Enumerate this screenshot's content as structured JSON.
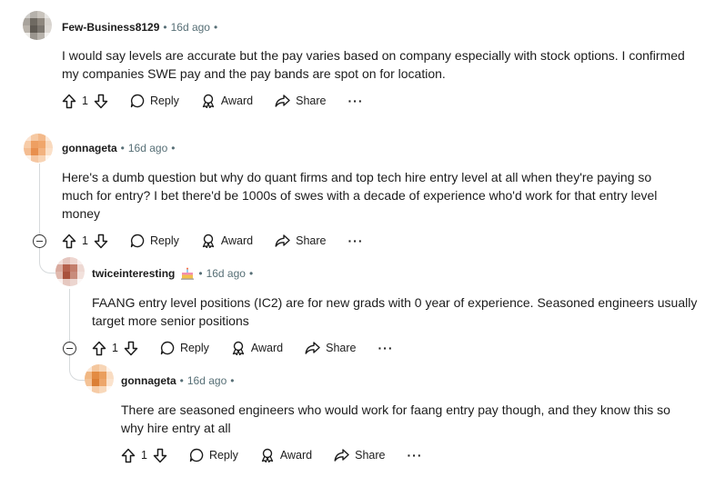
{
  "icons": {
    "upvote": "arrow-up-icon",
    "downvote": "arrow-down-icon",
    "reply": "speech-bubble-icon",
    "award": "award-icon",
    "share": "share-arrow-icon",
    "more": "ellipsis-icon",
    "collapse": "minus-circle-icon"
  },
  "labels": {
    "reply": "Reply",
    "award": "Award",
    "share": "Share",
    "more": "···",
    "separator": "•"
  },
  "comments": [
    {
      "author": "Few-Business8129",
      "time": "16d ago",
      "lines": [
        "I would say levels are accurate but the pay varies based on company especially with stock options. I confirmed",
        "my companies SWE pay and the pay bands are spot on for location."
      ],
      "votes": "1"
    },
    {
      "author": "gonnageta",
      "time": "16d ago",
      "lines": [
        "Here's a dumb question but why do quant firms and top tech hire entry level at all when they're paying so",
        "much for entry? I bet there'd be 1000s of swes with a decade of experience who'd work for that entry level",
        "money"
      ],
      "votes": "1"
    },
    {
      "author": "twiceinteresting",
      "time": "16d ago",
      "lines": [
        "FAANG entry level positions (IC2) are for new grads with 0 year of experience. Seasoned engineers usually",
        "target more senior positions"
      ],
      "votes": "1"
    },
    {
      "author": "gonnageta",
      "time": "16d ago",
      "lines": [
        "There are seasoned engineers who would work for faang entry pay though, and they know this so",
        "why hire entry at all"
      ],
      "votes": "1"
    }
  ]
}
